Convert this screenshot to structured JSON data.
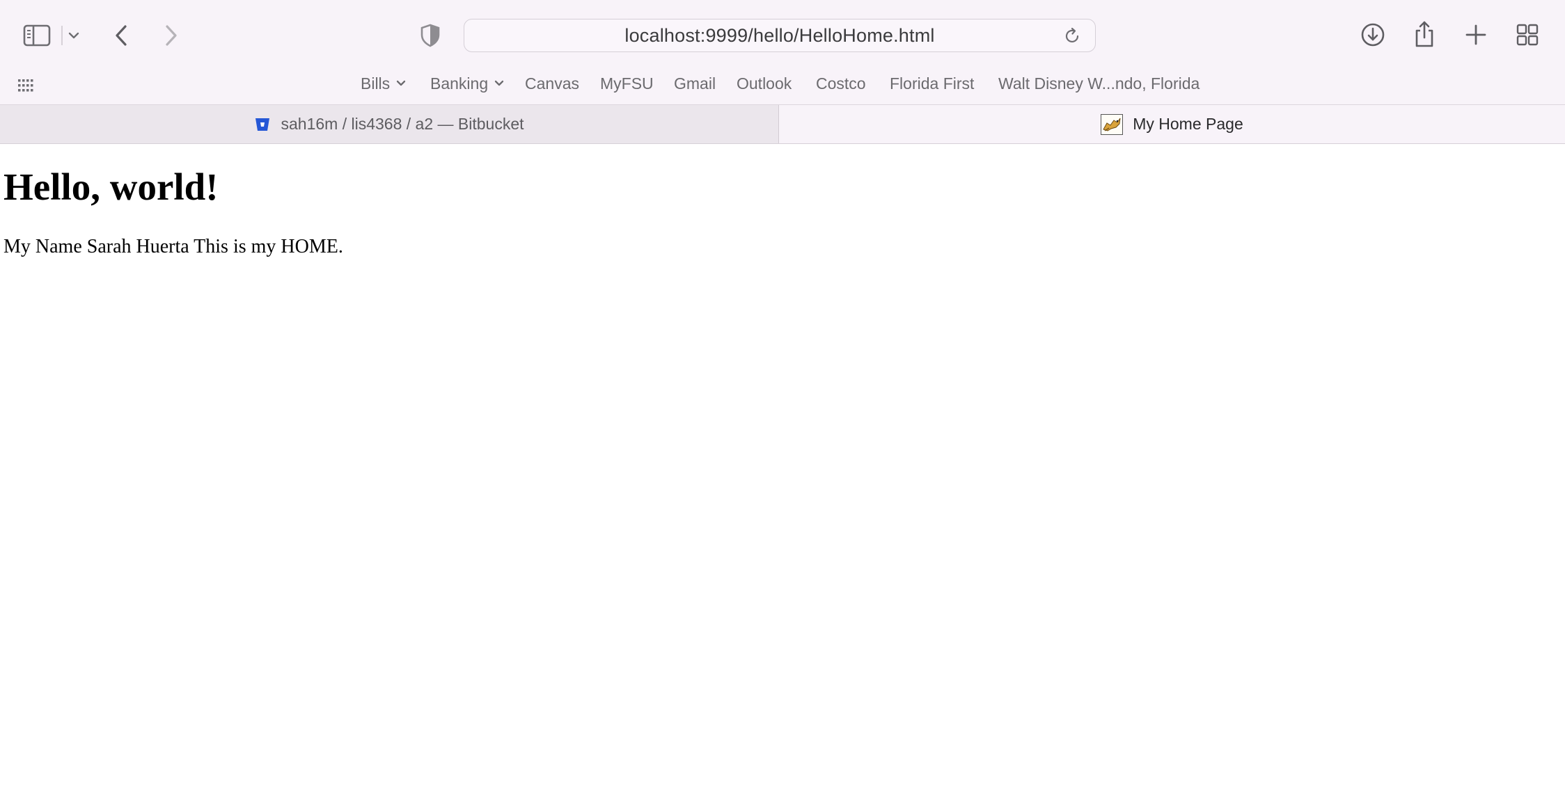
{
  "browser": {
    "url": "localhost:9999/hello/HelloHome.html",
    "icons": {
      "sidebar": "sidebar-icon",
      "sidebar_menu": "chevron-down-icon",
      "back": "back-icon",
      "forward": "forward-icon",
      "privacy": "privacy-shield-icon",
      "reload": "reload-icon",
      "downloads": "download-icon",
      "share": "share-icon",
      "new_tab": "plus-icon",
      "tab_overview": "grid-icon",
      "apps": "apps-grid-icon"
    }
  },
  "bookmarks": [
    {
      "label": "Bills",
      "folder": true
    },
    {
      "label": "Banking",
      "folder": true
    },
    {
      "label": "Canvas",
      "folder": false
    },
    {
      "label": "MyFSU",
      "folder": false
    },
    {
      "label": "Gmail",
      "folder": false
    },
    {
      "label": "Outlook",
      "folder": false
    },
    {
      "label": "Costco",
      "folder": false
    },
    {
      "label": "Florida First",
      "folder": false
    },
    {
      "label": "Walt Disney W...ndo, Florida",
      "folder": false
    }
  ],
  "tabs": [
    {
      "title": "sah16m / lis4368 / a2 — Bitbucket",
      "active": false,
      "favicon": "bitbucket-icon"
    },
    {
      "title": "My Home Page",
      "active": true,
      "favicon": "tomcat-icon"
    }
  ],
  "page": {
    "heading": "Hello, world!",
    "paragraph": "My Name Sarah Huerta This is my HOME."
  },
  "colors": {
    "chrome_bg": "#f8f3f9",
    "inactive_tab_bg": "#ebe6ec",
    "icon_gray": "#6e6d72",
    "bitbucket_blue": "#2557d6"
  }
}
